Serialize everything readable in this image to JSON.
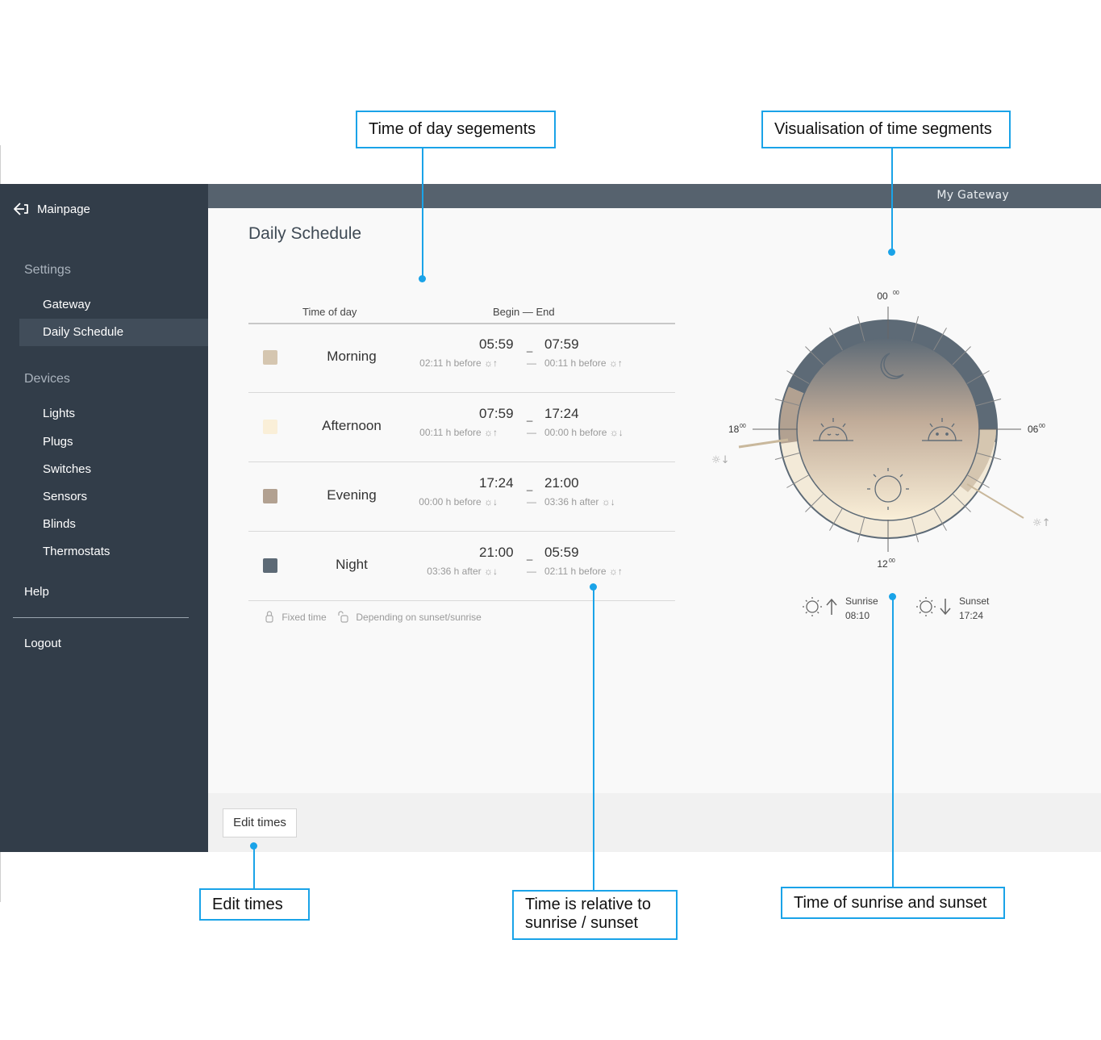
{
  "app": {
    "gateway_name": "My Gateway"
  },
  "sidebar": {
    "back_label": "Mainpage",
    "settings_heading": "Settings",
    "settings_items": [
      {
        "label": "Gateway"
      },
      {
        "label": "Daily Schedule"
      }
    ],
    "devices_heading": "Devices",
    "device_items": [
      {
        "label": "Lights"
      },
      {
        "label": "Plugs"
      },
      {
        "label": "Switches"
      },
      {
        "label": "Sensors"
      },
      {
        "label": "Blinds"
      },
      {
        "label": "Thermostats"
      }
    ],
    "help_label": "Help",
    "logout_label": "Logout"
  },
  "main": {
    "title": "Daily Schedule",
    "table": {
      "col_time_of_day": "Time of day",
      "col_begin_end": "Begin — End",
      "rows": [
        {
          "name": "Morning",
          "color": "#d5c6b0",
          "begin": "05:59",
          "end": "07:59",
          "begin_rel": "02:11 h before ☼↑",
          "end_rel": "00:11 h before ☼↑"
        },
        {
          "name": "Afternoon",
          "color": "#faefd8",
          "begin": "07:59",
          "end": "17:24",
          "begin_rel": "00:11 h before ☼↑",
          "end_rel": "00:00 h before ☼↓"
        },
        {
          "name": "Evening",
          "color": "#b2a191",
          "begin": "17:24",
          "end": "21:00",
          "begin_rel": "00:00 h before ☼↓",
          "end_rel": "03:36 h after ☼↓"
        },
        {
          "name": "Night",
          "color": "#5d6a76",
          "begin": "21:00",
          "end": "05:59",
          "begin_rel": "03:36 h after ☼↓",
          "end_rel": "02:11 h before ☼↑"
        }
      ]
    },
    "legend": {
      "fixed_time": "Fixed time",
      "depending": "Depending on sunset/sunrise"
    },
    "clock": {
      "label_00": "00",
      "label_06": "06",
      "label_12": "12",
      "label_18": "18",
      "minutes_sup": "00",
      "sunset_marker": "☼↓",
      "sunrise_marker": "☼↑"
    },
    "sun": {
      "sunrise_label": "Sunrise",
      "sunrise_time": "08:10",
      "sunset_label": "Sunset",
      "sunset_time": "17:24"
    }
  },
  "footer": {
    "edit_button": "Edit times"
  },
  "annotations": {
    "time_of_day_segments": "Time of day segements",
    "visualisation": "Visualisation of time segments",
    "edit_times": "Edit times",
    "relative_line1": "Time is relative to",
    "relative_line2": "sunrise / sunset",
    "sunrise_sunset": "Time of sunrise and sunset"
  }
}
